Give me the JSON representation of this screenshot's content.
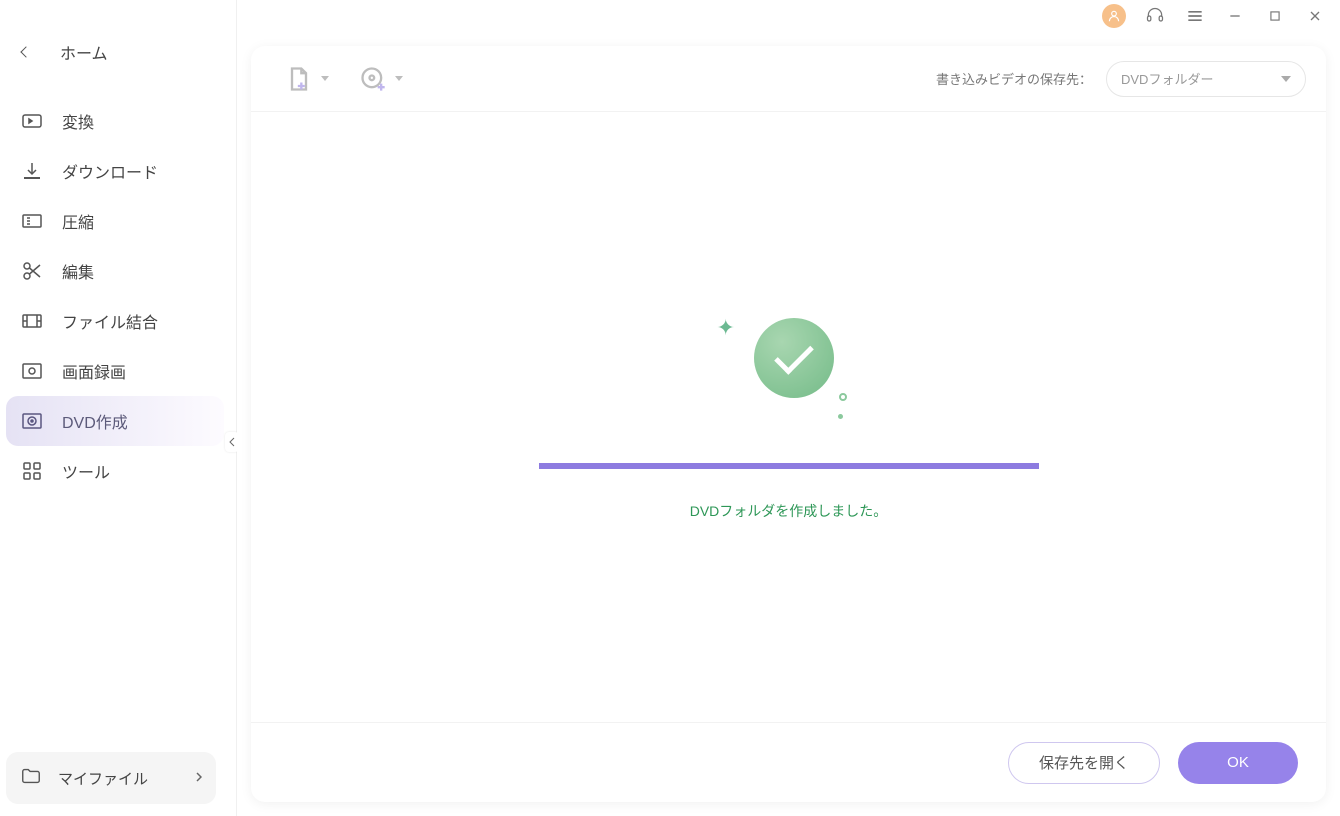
{
  "sidebar": {
    "home": "ホーム",
    "items": [
      {
        "id": "convert",
        "label": "変換"
      },
      {
        "id": "download",
        "label": "ダウンロード"
      },
      {
        "id": "compress",
        "label": "圧縮"
      },
      {
        "id": "edit",
        "label": "編集"
      },
      {
        "id": "merge",
        "label": "ファイル結合"
      },
      {
        "id": "record",
        "label": "画面録画"
      },
      {
        "id": "dvd",
        "label": "DVD作成"
      },
      {
        "id": "tools",
        "label": "ツール"
      }
    ],
    "active": "dvd",
    "my_files": "マイファイル"
  },
  "toolbar": {
    "burn_dest_label": "書き込みビデオの保存先：",
    "dest_value": "DVDフォルダー"
  },
  "result": {
    "status_text": "DVDフォルダを作成しました。"
  },
  "footer": {
    "open_btn": "保存先を開く",
    "ok_btn": "OK"
  }
}
